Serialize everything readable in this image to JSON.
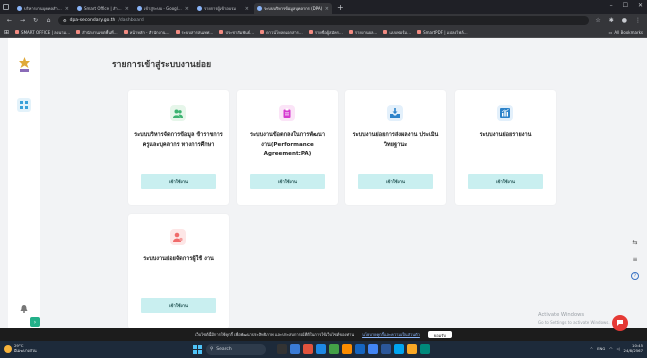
{
  "browser": {
    "tabs": [
      {
        "label": "บริหารงานบุคคลสำหรับผู้ดำเนินงาน",
        "active": false
      },
      {
        "label": "Smart Office | สำนักงาน…",
        "active": false
      },
      {
        "label": "เข้าสู่ระบบ - Google ไดรฟ์",
        "active": false
      },
      {
        "label": "รายการผู้เข้าอบรม",
        "active": false
      },
      {
        "label": "ระบบบริหารข้อมูลบุคลากร (DPA)",
        "active": true
      }
    ],
    "new_tab": "+",
    "url_domain": "dpa-secondary.go.th",
    "url_path": "/dashboard",
    "bookmarks": [
      "SMART OFFICE | ลงนาม…",
      "สำนักงานเขตพื้นที่…",
      "หน้าหลัก - สำนักงาน…",
      "ระบบสารสนเทศ…",
      "ประชาสัมพันธ์…",
      "ดาวน์โหลดเอกสาร…",
      "รายชื่อผู้สมัคร…",
      "รายงานผล…",
      "แบบฟอร์ม…",
      "SmartPDF | แปลงไฟล์…"
    ],
    "all_bookmarks": "All Bookmarks"
  },
  "page": {
    "title": "รายการเข้าสู่ระบบงานย่อย",
    "cards": [
      {
        "title": "ระบบบริหารจัดการข้อมูล ข้าราชการครูและบุคลากร ทางการศึกษา",
        "button": "เข้าใช้งาน",
        "icon": "users-icon",
        "icon_color": "#3cb371",
        "icon_bg": "#e6f6ea"
      },
      {
        "title": "ระบบงานข้อตกลงในการพัฒนา งาน(Performance Agreement:PA)",
        "button": "เข้าใช้งาน",
        "icon": "clipboard-icon",
        "icon_color": "#d63ad0",
        "icon_bg": "#fbe4f7"
      },
      {
        "title": "ระบบงานย่อยการส่งผลงาน ประเมินวิทยฐานะ",
        "button": "เข้าใช้งาน",
        "icon": "inbox-download-icon",
        "icon_color": "#2c82c9",
        "icon_bg": "#e3f0fb"
      },
      {
        "title": "ระบบงานย่อยรายงาน",
        "button": "เข้าใช้งาน",
        "icon": "bar-chart-icon",
        "icon_color": "#2c82c9",
        "icon_bg": "#e3f0fb"
      },
      {
        "title": "ระบบงานย่อยจัดการผู้ใช้ งาน",
        "button": "เข้าใช้งาน",
        "icon": "user-manage-icon",
        "icon_color": "#f06a6a",
        "icon_bg": "#fde6e6"
      }
    ],
    "activate_windows": "Activate Windows",
    "activate_windows_sub": "Go to Settings to activate Windows."
  },
  "cookie": {
    "text": "เว็บไซต์นี้มีการใช้คุกกี้ เพื่อพัฒนาประสิทธิภาพ และประสบการณ์ที่ดีในการใช้เว็บไซต์ของท่าน",
    "link": "นโยบายคุกกี้และความเป็นส่วนตัว",
    "accept": "ยอมรับ"
  },
  "taskbar": {
    "weather_temp": "29°C",
    "weather_text": "มีเมฆบางส่วน",
    "search_placeholder": "Search",
    "lang": "ENG",
    "time": "10:45",
    "date": "24/8/2567"
  },
  "colors": {
    "accent_button": "#c9eff0",
    "sidebar_active": "#e3f2fa",
    "fab": "#e53935"
  }
}
